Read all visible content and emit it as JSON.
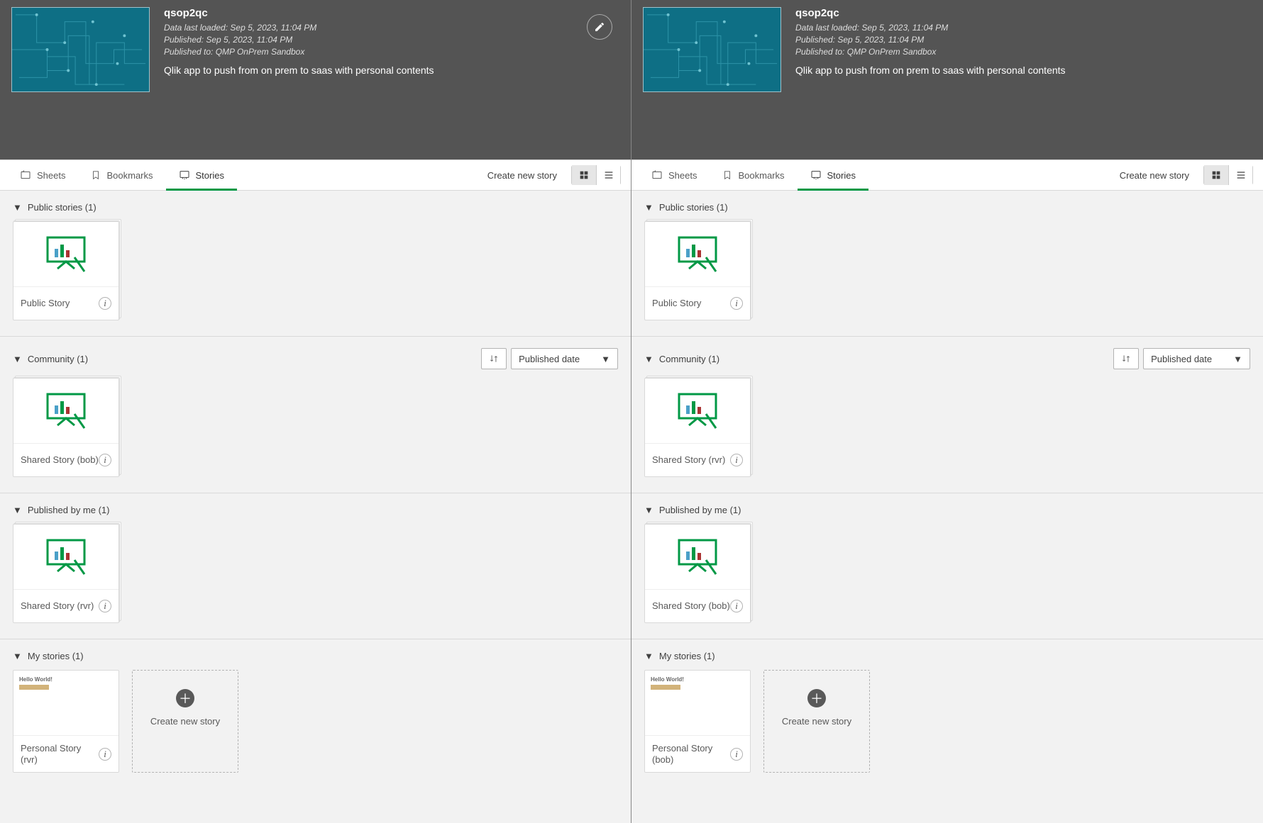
{
  "L": {
    "app": "qsop2qc",
    "meta1": "Data last loaded: Sep 5, 2023, 11:04 PM",
    "meta2": "Published: Sep 5, 2023, 11:04 PM",
    "meta3": "Published to: QMP OnPrem Sandbox",
    "desc": "Qlik app to push from on prem to saas with personal contents",
    "tabs": {
      "sheets": "Sheets",
      "bookmarks": "Bookmarks",
      "stories": "Stories",
      "create": "Create new story"
    },
    "sections": {
      "public": {
        "title": "Public stories (1)",
        "card1": "Public Story"
      },
      "community": {
        "title": "Community (1)",
        "sort": "Published date",
        "card1": "Shared Story (bob)"
      },
      "pubme": {
        "title": "Published by me (1)",
        "card1": "Shared Story (rvr)"
      },
      "mine": {
        "title": "My stories (1)",
        "card1": "Personal Story (rvr)",
        "mini": "Hello World!",
        "create": "Create new story"
      }
    }
  },
  "R": {
    "app": "qsop2qc",
    "meta1": "Data last loaded: Sep 5, 2023, 11:04 PM",
    "meta2": "Published: Sep 5, 2023, 11:04 PM",
    "meta3": "Published to: QMP OnPrem Sandbox",
    "desc": "Qlik app to push from on prem to saas with personal contents",
    "tabs": {
      "sheets": "Sheets",
      "bookmarks": "Bookmarks",
      "stories": "Stories",
      "create": "Create new story"
    },
    "sections": {
      "public": {
        "title": "Public stories (1)",
        "card1": "Public Story"
      },
      "community": {
        "title": "Community (1)",
        "sort": "Published date",
        "card1": "Shared Story (rvr)"
      },
      "pubme": {
        "title": "Published by me (1)",
        "card1": "Shared Story (bob)"
      },
      "mine": {
        "title": "My stories (1)",
        "card1": "Personal Story (bob)",
        "mini": "Hello World!",
        "create": "Create new story"
      }
    }
  }
}
